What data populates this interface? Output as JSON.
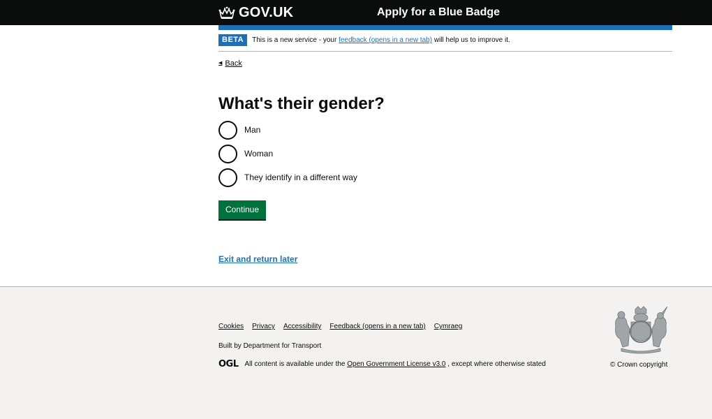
{
  "header": {
    "logo_text": "GOV.UK",
    "logo_icon": "crown-icon",
    "service_name": "Apply for a Blue Badge",
    "colors": {
      "background": "#0b0c0c",
      "accent_bar": "#1d70b8"
    }
  },
  "phase_banner": {
    "tag": "BETA",
    "text_before": "This is a new service - your",
    "link_text": "feedback (opens in a new tab)",
    "text_after": "will help us to improve it."
  },
  "back_link": {
    "label": "Back",
    "icon": "chevron-left-icon"
  },
  "question": {
    "heading": "What's their gender?",
    "options": [
      {
        "label": "Man",
        "selected": false
      },
      {
        "label": "Woman",
        "selected": false
      },
      {
        "label": "They identify in a different way",
        "selected": false
      }
    ]
  },
  "continue_button": {
    "label": "Continue",
    "color": "#00703c"
  },
  "exit_link": {
    "label": "Exit and return later"
  },
  "footer": {
    "links": [
      "Cookies",
      "Privacy",
      "Accessibility",
      "Feedback (opens in a new tab)",
      "Cymraeg"
    ],
    "built_by": "Built by Department for Transport",
    "ogl_logo": "OGL",
    "licence_before": "All content is available under the",
    "licence_link": "Open Government License v3.0",
    "licence_after": ", except where otherwise stated",
    "crest_icon": "royal-coat-of-arms-icon",
    "copyright": "© Crown copyright",
    "background": "#f3f2f1"
  }
}
